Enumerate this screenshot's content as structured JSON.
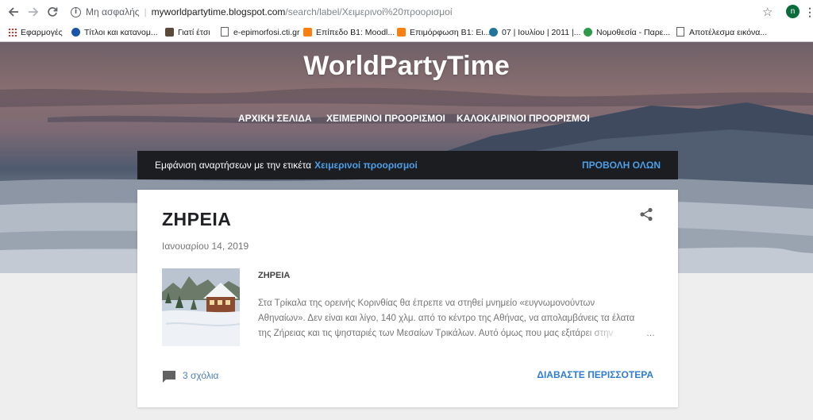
{
  "browser": {
    "security_label": "Μη ασφαλής",
    "url_host": "myworldpartytime.blogspot.com",
    "url_path": "/search/label/Χειμερινοί%20προορισμοί",
    "profile_initial": "n"
  },
  "bookmarks": [
    {
      "label": "Εφαρμογές",
      "icon": "apps-grid-icon"
    },
    {
      "label": "Τίτλοι και κατανομ...",
      "icon": "globe-icon"
    },
    {
      "label": "Γιατί έτσι",
      "icon": "image-icon"
    },
    {
      "label": "e-epimorfosi.cti.gr",
      "icon": "page-icon"
    },
    {
      "label": "Επίπεδο Β1: Moodl...",
      "icon": "moodle-icon"
    },
    {
      "label": "Επιμόρφωση Β1: Ει...",
      "icon": "moodle-icon"
    },
    {
      "label": "07 | Ιουλίου | 2011 |...",
      "icon": "wordpress-icon"
    },
    {
      "label": "Νομοθεσία - Παρε...",
      "icon": "flower-icon"
    },
    {
      "label": "Αποτέλεσμα εικόνα...",
      "icon": "page-icon"
    }
  ],
  "site": {
    "title": "WorldPartyTime",
    "nav": [
      "ΑΡΧΙΚΗ ΣΕΛΙΔΑ",
      "ΧΕΙΜΕΡΙΝΟΙ ΠΡΟΟΡΙΣΜΟΙ",
      "ΚΑΛΟΚΑΙΡΙΝΟΙ ΠΡΟΟΡΙΣΜΟΙ"
    ]
  },
  "label_banner": {
    "text": "Εμφάνιση αναρτήσεων με την ετικέτα",
    "label": "Χειμερινοί προορισμοί",
    "view_all": "ΠΡΟΒΟΛΗ ΟΛΩΝ"
  },
  "post": {
    "title": "ΖΗΡΕΙΑ",
    "date": "Ιανουαρίου 14, 2019",
    "snippet_title": "ΖΗΡΕΙΑ",
    "snippet_lines": [
      "Στα Τρίκαλα της ορεινής Κορινθίας θα έπρεπε να στηθεί μνημείο «ευγνωμονούντων",
      "Αθηναίων». Δεν είναι και λίγο, 140 χλμ. από το κέντρο της Αθήνας, να απολαμβάνεις τα έλατα",
      "της Ζήρειας και τις ψησταριές των Μεσαίων Τρικάλων. Αυτό όμως που μας εξιτάρει στην"
    ],
    "ellipsis": "…",
    "comments": "3 σχόλια",
    "read_more": "ΔΙΑΒΑΣΤΕ ΠΕΡΙΣΣΟΤΕΡΑ"
  }
}
